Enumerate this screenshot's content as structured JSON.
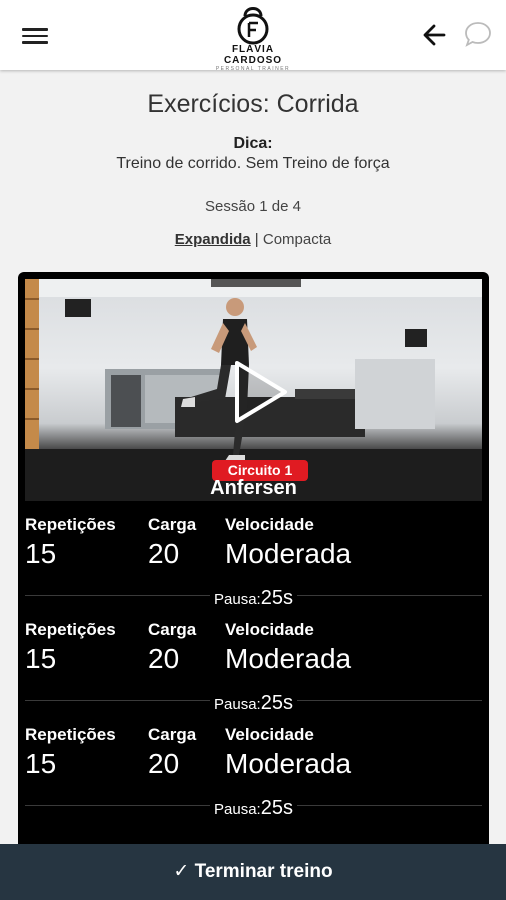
{
  "header": {
    "logo_name": "FLÁVIA CARDOSO",
    "logo_sub": "PERSONAL TRAINER",
    "menu_icon": "menu-icon",
    "back_icon": "arrow-left-icon",
    "chat_icon": "chat-bubble-icon"
  },
  "page": {
    "title": "Exercícios: Corrida",
    "tip_label": "Dica:",
    "tip_text": "Treino de corrido. Sem Treino de força",
    "session": "Sessão 1 de 4",
    "view_expanded": "Expandida",
    "view_separator": " | ",
    "view_compact": "Compacta"
  },
  "exercise": {
    "circuit": "Circuito 1",
    "name": "Anfersen",
    "labels": {
      "reps": "Repetições",
      "load": "Carga",
      "speed": "Velocidade",
      "pause": "Pausa:"
    },
    "sets": [
      {
        "reps": "15",
        "load": "20",
        "speed": "Moderada",
        "pause": "25s"
      },
      {
        "reps": "15",
        "load": "20",
        "speed": "Moderada",
        "pause": "25s"
      },
      {
        "reps": "15",
        "load": "20",
        "speed": "Moderada",
        "pause": "25s"
      }
    ]
  },
  "footer": {
    "finish_label": "✓ Terminar treino"
  },
  "colors": {
    "topbar": "#ffffff",
    "background": "#f2f2f2",
    "card": "#000000",
    "badge": "#e01b22",
    "bottom_bar": "#263541"
  }
}
